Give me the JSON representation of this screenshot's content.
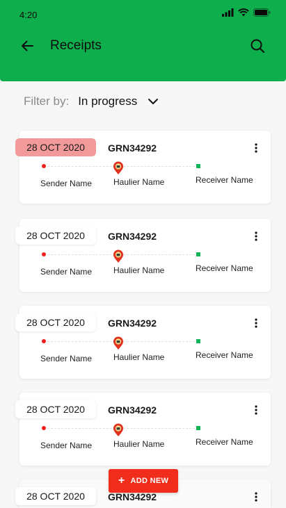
{
  "status_bar": {
    "time": "4:20"
  },
  "toolbar": {
    "title": "Receipts"
  },
  "filter": {
    "label": "Filter by:",
    "value": "In progress"
  },
  "receipts": [
    {
      "date": "28 OCT 2020",
      "grn": "GRN34292",
      "sender": "Sender Name",
      "haulier": "Haulier Name",
      "receiver": "Receiver Name",
      "highlighted": true
    },
    {
      "date": "28 OCT 2020",
      "grn": "GRN34292",
      "sender": "Sender Name",
      "haulier": "Haulier Name",
      "receiver": "Receiver Name",
      "highlighted": false
    },
    {
      "date": "28 OCT 2020",
      "grn": "GRN34292",
      "sender": "Sender Name",
      "haulier": "Haulier Name",
      "receiver": "Receiver Name",
      "highlighted": false
    },
    {
      "date": "28 OCT 2020",
      "grn": "GRN34292",
      "sender": "Sender Name",
      "haulier": "Haulier Name",
      "receiver": "Receiver Name",
      "highlighted": false
    },
    {
      "date": "28 OCT 2020",
      "grn": "GRN34292",
      "sender": "",
      "haulier": "",
      "receiver": "",
      "highlighted": false
    }
  ],
  "fab": {
    "label": "ADD NEW"
  },
  "colors": {
    "brand": "#0fae4d",
    "accent": "#f02d1b",
    "highlight": "#f29a9a",
    "sender": "#f21f1f",
    "receiver": "#13b35a"
  },
  "icons": {
    "back": "arrow-left-icon",
    "search": "search-icon",
    "filter": "chevron-down-icon",
    "more": "more-vertical-icon",
    "haulier": "map-pin-icon",
    "add": "plus-icon"
  }
}
